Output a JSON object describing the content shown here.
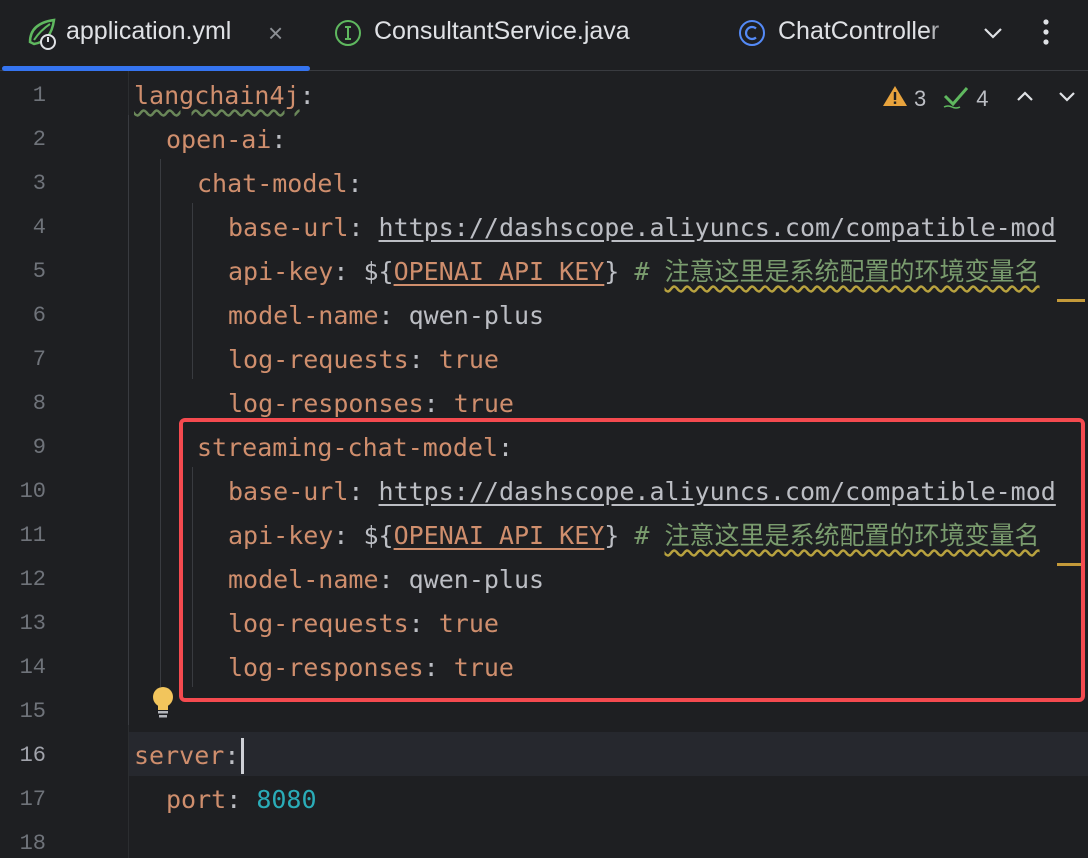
{
  "tabs": [
    {
      "label": "application.yml",
      "icon": "spring-yaml-icon",
      "active": true
    },
    {
      "label": "ConsultantService.java",
      "icon": "interface-icon",
      "active": false
    },
    {
      "label": "ChatController",
      "icon": "class-icon",
      "active": false
    }
  ],
  "inspections": {
    "warnings": "3",
    "ok": "4"
  },
  "editor": {
    "current_line": "16",
    "lines": [
      {
        "num": "1",
        "key": "langchain4j",
        "sep": ":"
      },
      {
        "num": "2",
        "key": "open-ai",
        "sep": ":"
      },
      {
        "num": "3",
        "key": "chat-model",
        "sep": ":"
      },
      {
        "num": "4",
        "key": "base-url",
        "sep": ": ",
        "url": "https://dashscope.aliyuncs.com/compatible-mod"
      },
      {
        "num": "5",
        "key": "api-key",
        "sep": ": ",
        "pre": "${",
        "var": "OPENAI_API_KEY",
        "post": "}",
        "hash": " # ",
        "comment": "注意这里是系统配置的环境变量名"
      },
      {
        "num": "6",
        "key": "model-name",
        "sep": ": ",
        "value": "qwen-plus"
      },
      {
        "num": "7",
        "key": "log-requests",
        "sep": ": ",
        "value": "true"
      },
      {
        "num": "8",
        "key": "log-responses",
        "sep": ": ",
        "value": "true"
      },
      {
        "num": "9",
        "key": "streaming-chat-model",
        "sep": ":"
      },
      {
        "num": "10",
        "key": "base-url",
        "sep": ": ",
        "url": "https://dashscope.aliyuncs.com/compatible-mod"
      },
      {
        "num": "11",
        "key": "api-key",
        "sep": ": ",
        "pre": "${",
        "var": "OPENAI_API_KEY",
        "post": "}",
        "hash": " # ",
        "comment": "注意这里是系统配置的环境变量名"
      },
      {
        "num": "12",
        "key": "model-name",
        "sep": ": ",
        "value": "qwen-plus"
      },
      {
        "num": "13",
        "key": "log-requests",
        "sep": ": ",
        "value": "true"
      },
      {
        "num": "14",
        "key": "log-responses",
        "sep": ": ",
        "value": "true"
      },
      {
        "num": "15"
      },
      {
        "num": "16",
        "key": "server",
        "sep": ":"
      },
      {
        "num": "17",
        "key": "port",
        "sep": ": ",
        "number": "8080"
      },
      {
        "num": "18"
      }
    ]
  },
  "colors": {
    "background": "#1e1f22",
    "key": "#cf8e6d",
    "number": "#2aacb8",
    "comment": "#7a9c6e",
    "highlight_box": "#f44a4f",
    "active_tab_underline": "#3574f0"
  }
}
